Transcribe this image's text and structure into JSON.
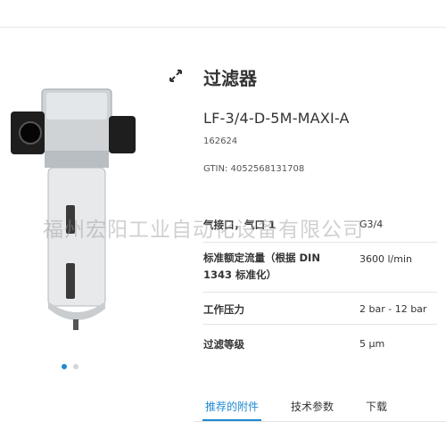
{
  "product": {
    "title": "过滤器",
    "model": "LF-3/4-D-5M-MAXI-A",
    "part_number": "162624",
    "gtin": "GTIN: 4052568131708"
  },
  "specs": [
    {
      "label": "气接口，气口 1",
      "value": "G3/4"
    },
    {
      "label": "标准额定流量（根据 DIN 1343 标准化）",
      "value": "3600 l/min"
    },
    {
      "label": "工作压力",
      "value": "2 bar - 12 bar"
    },
    {
      "label": "过滤等级",
      "value": "5 µm"
    }
  ],
  "tabs": [
    {
      "label": "推荐的附件",
      "active": true
    },
    {
      "label": "技术参数",
      "active": false
    },
    {
      "label": "下载",
      "active": false
    }
  ],
  "gallery": {
    "image_count": 2,
    "active_index": 0
  },
  "watermark": "福州宏阳工业自动化设备有限公司",
  "colors": {
    "accent": "#1f8ad3",
    "text": "#333333",
    "divider": "#e2e2e2"
  },
  "icons": {
    "expand": "expand-arrows-icon"
  }
}
